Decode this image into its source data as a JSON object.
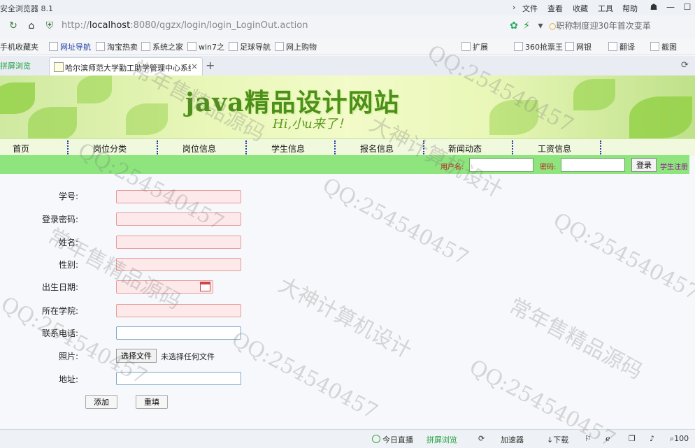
{
  "browser": {
    "window_title": "安全浏览器 8.1",
    "menu": [
      "文件",
      "查看",
      "收藏",
      "工具",
      "帮助"
    ],
    "url_prefix": "http://",
    "url_host": "localhost",
    "url_rest": ":8080/qgzx/login/login_LoginOut.action",
    "search_text": "职称制度迎30年首次变革",
    "bookmarks": [
      "手机收藏夹",
      "网址导航",
      "淘宝热卖",
      "系统之家",
      "win7之",
      "足球导航",
      "网上购物"
    ],
    "toolbar_right": [
      "扩展",
      "360抢票王",
      "网银",
      "翻译",
      "截图"
    ],
    "tab_split": "拼屏浏览",
    "tab_title": "哈尔滨师范大学勤工助学管理中心系统",
    "icons": {
      "back": "back-arrow-icon",
      "refresh": "refresh-icon",
      "home": "home-icon",
      "shield": "shield-icon"
    }
  },
  "site": {
    "title": "java精品设计网站",
    "slogan": "Hi,小u来了！",
    "nav": [
      "首页",
      "岗位分类",
      "岗位信息",
      "学生信息",
      "报名信息",
      "新闻动态",
      "工资信息"
    ]
  },
  "login": {
    "username_label": "用户名:",
    "password_label": "密码:",
    "login_button": "登录",
    "register_link": "学生注册"
  },
  "form": {
    "fields": [
      "学号:",
      "登录密码:",
      "姓名:",
      "性别:",
      "出生日期:",
      "所在学院:",
      "联系电话:",
      "照片:",
      "地址:"
    ],
    "file_button": "选择文件",
    "file_status": "未选择任何文件",
    "submit": "添加",
    "reset": "重填"
  },
  "statusbar": {
    "items": [
      "今日直播",
      "拼屏浏览",
      "加速器",
      "下载"
    ],
    "zoom": "100"
  },
  "watermark": [
    "常年售精品源码",
    "QQ:254540457",
    "大神计算机设计"
  ],
  "colors": {
    "accent_green": "#8ee57e",
    "nav_separator": "#2a3da8",
    "label_red": "#c01c1c"
  }
}
